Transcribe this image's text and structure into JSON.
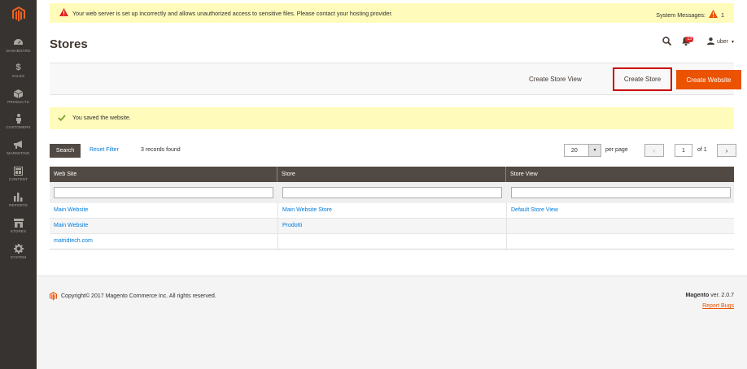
{
  "sidebar": {
    "items": [
      {
        "label": "DASHBOARD",
        "icon": "dashboard-icon"
      },
      {
        "label": "SALES",
        "icon": "dollar-icon"
      },
      {
        "label": "PRODUCTS",
        "icon": "cube-icon"
      },
      {
        "label": "CUSTOMERS",
        "icon": "person-icon"
      },
      {
        "label": "MARKETING",
        "icon": "megaphone-icon"
      },
      {
        "label": "CONTENT",
        "icon": "layout-icon"
      },
      {
        "label": "REPORTS",
        "icon": "bar-chart-icon"
      },
      {
        "label": "STORES",
        "icon": "storefront-icon"
      },
      {
        "label": "SYSTEM",
        "icon": "gear-icon"
      }
    ]
  },
  "system_message": {
    "text": "Your web server is set up incorrectly and allows unauthorized access to sensitive files. Please contact your hosting provider.",
    "label": "System Messages:",
    "count": "1"
  },
  "header": {
    "title": "Stores",
    "notifications_count": "13",
    "user": "uber"
  },
  "actions": {
    "create_store_view": "Create Store View",
    "create_store": "Create Store",
    "create_website": "Create Website"
  },
  "success_message": "You saved the website.",
  "toolbar": {
    "search": "Search",
    "reset": "Reset Filter",
    "records": "3 records found",
    "per_page_value": "20",
    "per_page_label": "per page",
    "page": "1",
    "of_pages": "of 1"
  },
  "grid": {
    "columns": [
      "Web Site",
      "Store",
      "Store View"
    ],
    "rows": [
      [
        "Main Website",
        "Main Website Store",
        "Default Store View"
      ],
      [
        "Main Website",
        "Prodotti",
        ""
      ],
      [
        "matridtech.com",
        "",
        ""
      ]
    ]
  },
  "footer": {
    "copyright": "Copyright© 2017 Magento Commerce Inc. All rights reserved.",
    "brand": "Magento",
    "version": " ver. 2.0.7",
    "report_bugs": "Report Bugs"
  },
  "colors": {
    "accent": "#eb5202",
    "sidebar": "#373330",
    "header_dark": "#514943",
    "link": "#007bdb",
    "notice_bg": "#fffbbb"
  }
}
